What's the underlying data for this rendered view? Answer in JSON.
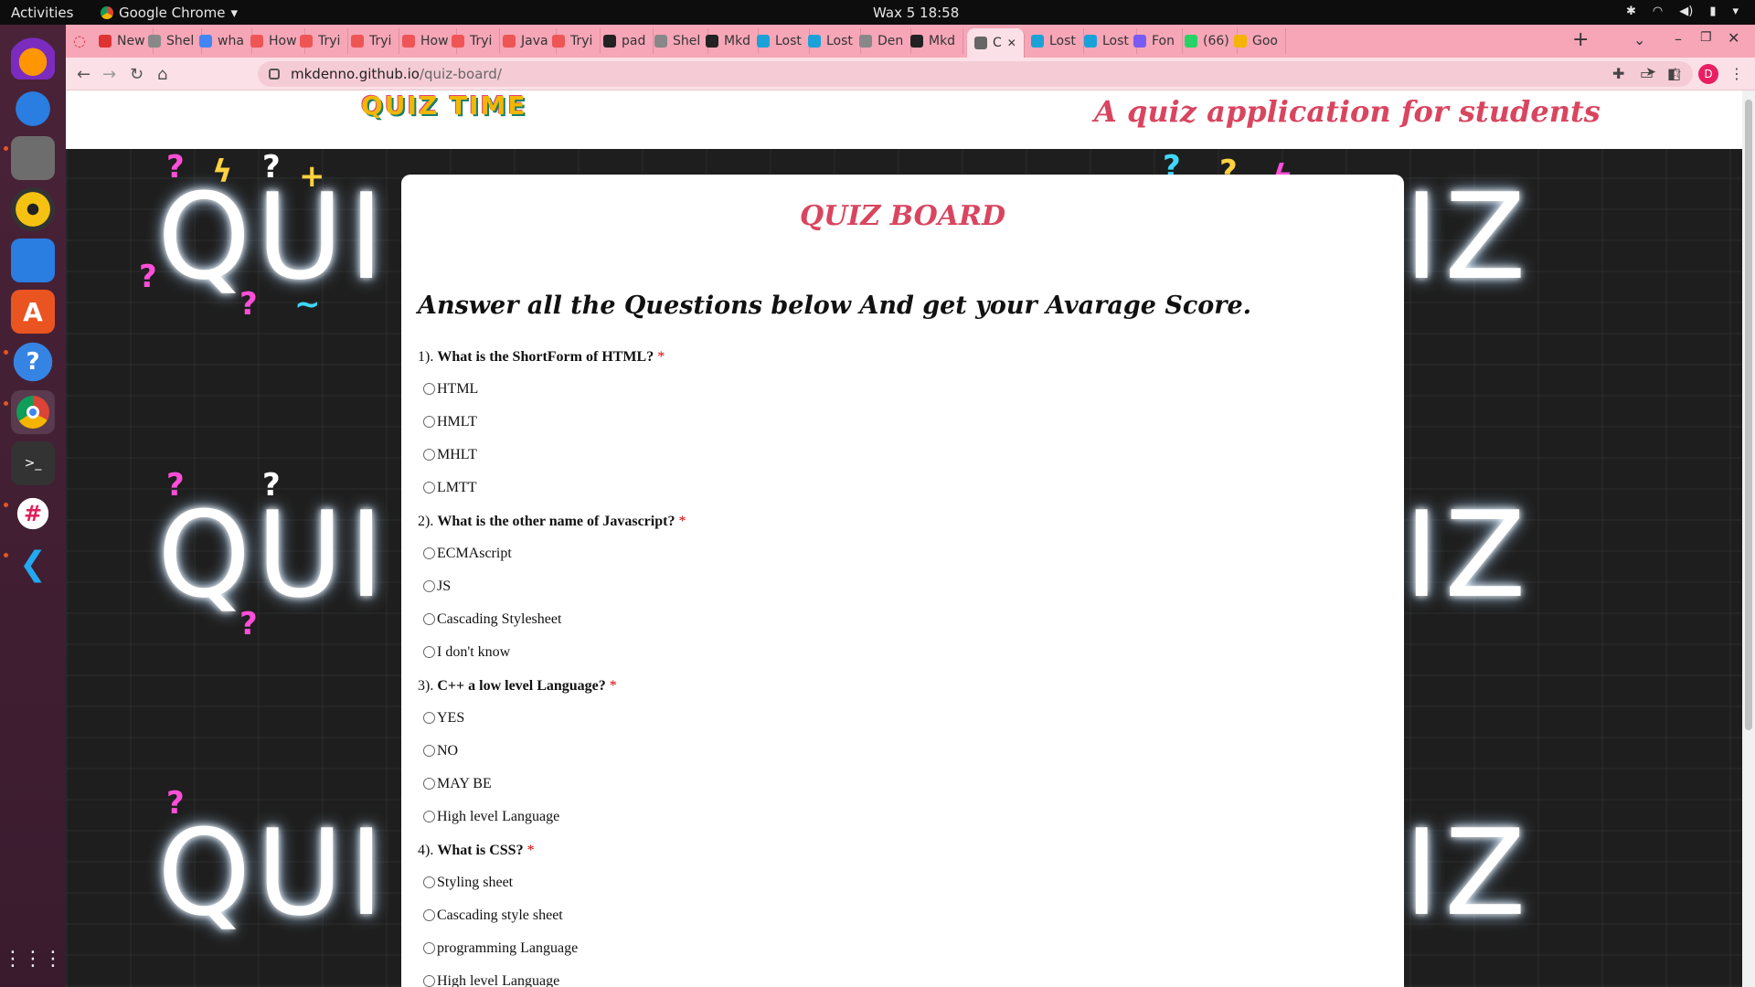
{
  "system": {
    "activities": "Activities",
    "app_name": "Google Chrome",
    "clock": "Wax 5  18:58"
  },
  "dock": {
    "items": [
      "firefox-icon",
      "thunderbird-icon",
      "files-icon",
      "rhythmbox-icon",
      "writer-icon",
      "software-icon",
      "help-icon",
      "chrome-icon",
      "terminal-icon",
      "slack-icon",
      "vscode-icon"
    ],
    "show_apps": "apps-grid-icon"
  },
  "browser": {
    "tabs": [
      "New",
      "Shel",
      "wha",
      "How",
      "Tryi",
      "Tryi",
      "How",
      "Tryi",
      "Java",
      "Tryi",
      "pad",
      "Shel",
      "Mkd",
      "Lost",
      "Lost",
      "Den",
      "Mkd",
      "C",
      "Lost",
      "Lost",
      "Fon",
      "(66)",
      "Goo"
    ],
    "active_tab_index": 17,
    "url_host": "mkdenno.github.io",
    "url_path": "/quiz-board/",
    "profile_initial": "D"
  },
  "site": {
    "logo": "QUIZ TIME",
    "tagline": "A quiz application for students",
    "board_title": "QUIZ BOARD",
    "instructions": "Answer all the Questions below And get your Avarage Score.",
    "required_mark": "*"
  },
  "questions": [
    {
      "number": "1).",
      "text": "What is the ShortForm of HTML?",
      "options": [
        "HTML",
        "HMLT",
        "MHLT",
        "LMTT"
      ]
    },
    {
      "number": "2).",
      "text": "What is the other name of Javascript?",
      "options": [
        "ECMAscript",
        "JS",
        "Cascading Stylesheet",
        "I don't know"
      ]
    },
    {
      "number": "3).",
      "text": "C++ a low level Language?",
      "options": [
        "YES",
        "NO",
        "MAY BE",
        "High level Language"
      ]
    },
    {
      "number": "4).",
      "text": "What is CSS?",
      "options": [
        "Styling sheet",
        "Cascading style sheet",
        "programming Language",
        "High level Language"
      ]
    }
  ],
  "colors": {
    "tabstrip": "#f6a6b7",
    "toolbar": "#fbe1e7",
    "accent_title": "#d9455f",
    "required": "#dd0000"
  }
}
